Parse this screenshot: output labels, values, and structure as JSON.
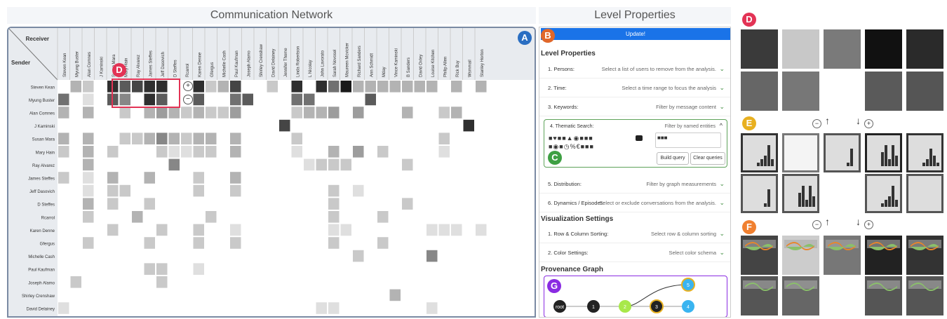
{
  "titles": {
    "network": "Communication Network",
    "levels": "Level Properties"
  },
  "matrix": {
    "corner_receiver": "Receiver",
    "corner_sender": "Sender",
    "columns": [
      "Steven Kean",
      "Myung Buster",
      "Alan Comnes",
      "J Kaminski",
      "Susan Mara",
      "Mary Hain",
      "Ray Alvarez",
      "James Steffes",
      "Jeff Dasovich",
      "D Steffes",
      "Rcarrol",
      "Karen Denne",
      "Gfergus",
      "Michelle Cash",
      "Paul Kaufman",
      "Joseph Alamo",
      "Shirley Crenshaw",
      "David Delainey",
      "Jennifer Thome",
      "Linda Robertson",
      "L Nicolay",
      "John Lavorato",
      "Sarah Novosel",
      "Maureen Mcvicker",
      "Richard Sanders",
      "Ann Schmidt",
      "Mday",
      "Vince Kaminski",
      "B Sanders",
      "David Oxley",
      "Louise Kitchen",
      "Philip Allen",
      "Rick Buy",
      "Wsmmail",
      "Stanley Horton"
    ],
    "rows": [
      "Steven Kean",
      "Myung Buster",
      "Alan Comnes",
      "J Kaminski",
      "Susan Mara",
      "Mary Hain",
      "Ray Alvarez",
      "James Steffes",
      "Jeff Dasovich",
      "D Steffes",
      "Rcarrol",
      "Karen Denne",
      "Gfergus",
      "Michelle Cash",
      "Paul Kaufman",
      "Joseph Alamo",
      "Shirley Crenshaw",
      "David Delainey"
    ],
    "cells": [
      [
        0,
        3,
        2,
        0,
        9,
        7,
        8,
        9,
        9,
        0,
        0,
        9,
        2,
        3,
        8,
        0,
        0,
        2,
        0,
        9,
        0,
        9,
        6,
        10,
        3,
        3,
        3,
        3,
        3,
        3,
        3,
        0,
        3,
        0,
        3
      ],
      [
        6,
        0,
        1,
        0,
        7,
        5,
        0,
        9,
        7,
        0,
        0,
        7,
        0,
        0,
        6,
        7,
        0,
        0,
        0,
        6,
        6,
        0,
        0,
        0,
        0,
        7,
        0,
        0,
        0,
        0,
        0,
        0,
        0,
        0,
        0
      ],
      [
        3,
        0,
        3,
        0,
        0,
        2,
        0,
        3,
        4,
        3,
        2,
        3,
        2,
        2,
        4,
        0,
        0,
        0,
        0,
        2,
        3,
        3,
        4,
        0,
        4,
        0,
        0,
        0,
        3,
        0,
        0,
        2,
        3,
        0,
        0
      ],
      [
        0,
        0,
        0,
        0,
        0,
        0,
        0,
        0,
        0,
        0,
        0,
        0,
        0,
        0,
        0,
        0,
        0,
        0,
        8,
        0,
        0,
        0,
        0,
        0,
        0,
        0,
        0,
        0,
        0,
        0,
        0,
        0,
        0,
        9,
        0
      ],
      [
        3,
        0,
        3,
        0,
        0,
        2,
        2,
        3,
        5,
        3,
        2,
        3,
        3,
        0,
        3,
        0,
        0,
        0,
        0,
        2,
        0,
        0,
        0,
        0,
        0,
        0,
        0,
        0,
        0,
        0,
        0,
        2,
        0,
        0,
        0
      ],
      [
        2,
        0,
        3,
        0,
        2,
        0,
        0,
        0,
        2,
        1,
        1,
        2,
        2,
        0,
        3,
        0,
        0,
        0,
        0,
        1,
        0,
        0,
        3,
        0,
        4,
        0,
        2,
        0,
        0,
        0,
        0,
        1,
        0,
        0,
        0
      ],
      [
        0,
        0,
        3,
        0,
        0,
        0,
        0,
        0,
        0,
        5,
        0,
        0,
        0,
        0,
        0,
        0,
        0,
        0,
        0,
        0,
        1,
        2,
        2,
        2,
        0,
        0,
        0,
        0,
        2,
        0,
        0,
        0,
        0,
        0,
        0
      ],
      [
        2,
        0,
        1,
        0,
        3,
        0,
        0,
        3,
        0,
        0,
        0,
        2,
        0,
        0,
        3,
        0,
        0,
        0,
        0,
        0,
        0,
        0,
        0,
        0,
        0,
        0,
        0,
        0,
        0,
        0,
        0,
        0,
        0,
        0,
        0
      ],
      [
        0,
        0,
        1,
        0,
        2,
        2,
        0,
        0,
        0,
        0,
        0,
        2,
        0,
        0,
        2,
        0,
        0,
        0,
        0,
        0,
        0,
        0,
        2,
        0,
        1,
        0,
        0,
        0,
        0,
        0,
        0,
        0,
        0,
        0,
        0
      ],
      [
        0,
        0,
        3,
        0,
        2,
        0,
        0,
        2,
        0,
        0,
        0,
        0,
        0,
        0,
        0,
        0,
        0,
        0,
        0,
        0,
        0,
        0,
        2,
        0,
        0,
        0,
        0,
        0,
        2,
        0,
        0,
        0,
        0,
        0,
        0
      ],
      [
        0,
        0,
        2,
        0,
        0,
        0,
        3,
        0,
        0,
        0,
        0,
        0,
        2,
        0,
        0,
        0,
        0,
        0,
        0,
        0,
        0,
        0,
        2,
        0,
        0,
        0,
        2,
        0,
        0,
        0,
        0,
        0,
        0,
        0,
        0
      ],
      [
        0,
        0,
        0,
        0,
        2,
        0,
        0,
        0,
        2,
        0,
        0,
        2,
        0,
        0,
        1,
        0,
        0,
        0,
        0,
        0,
        0,
        0,
        1,
        1,
        0,
        0,
        0,
        0,
        0,
        0,
        1,
        1,
        1,
        0,
        1
      ],
      [
        0,
        0,
        2,
        0,
        0,
        0,
        0,
        2,
        0,
        0,
        0,
        2,
        0,
        0,
        2,
        0,
        0,
        0,
        0,
        0,
        0,
        0,
        2,
        0,
        0,
        0,
        2,
        0,
        0,
        0,
        0,
        0,
        0,
        0,
        0
      ],
      [
        0,
        0,
        0,
        0,
        0,
        0,
        0,
        0,
        0,
        0,
        0,
        0,
        0,
        0,
        0,
        0,
        0,
        0,
        0,
        0,
        0,
        0,
        0,
        0,
        2,
        0,
        0,
        0,
        0,
        0,
        5,
        0,
        0,
        0,
        0
      ],
      [
        0,
        0,
        0,
        0,
        0,
        0,
        0,
        2,
        2,
        0,
        0,
        1,
        0,
        0,
        0,
        0,
        0,
        0,
        0,
        0,
        0,
        0,
        0,
        0,
        0,
        0,
        0,
        0,
        0,
        0,
        0,
        0,
        0,
        0,
        0
      ],
      [
        0,
        2,
        0,
        0,
        0,
        0,
        0,
        0,
        2,
        0,
        0,
        0,
        0,
        0,
        0,
        0,
        0,
        0,
        0,
        0,
        0,
        0,
        0,
        0,
        0,
        0,
        0,
        0,
        0,
        0,
        0,
        0,
        0,
        0,
        0
      ],
      [
        0,
        0,
        0,
        0,
        0,
        0,
        0,
        0,
        0,
        0,
        0,
        0,
        0,
        0,
        0,
        0,
        0,
        0,
        0,
        0,
        0,
        0,
        0,
        0,
        0,
        0,
        0,
        3,
        0,
        0,
        0,
        0,
        0,
        0,
        0
      ],
      [
        1,
        0,
        0,
        0,
        0,
        0,
        0,
        0,
        0,
        0,
        0,
        0,
        0,
        0,
        0,
        0,
        0,
        0,
        0,
        0,
        0,
        1,
        1,
        0,
        0,
        0,
        0,
        0,
        0,
        0,
        1,
        0,
        0,
        0,
        0
      ]
    ]
  },
  "badges": {
    "a": "A",
    "b": "B",
    "c": "C",
    "d": "D",
    "e": "E",
    "f": "F",
    "g": "G"
  },
  "badge_colors": {
    "a": "#2a6ec2",
    "b": "#e0672a",
    "c": "#3ea043",
    "d": "#e33355",
    "e": "#e8b020",
    "f": "#f08030",
    "g": "#8a2be2"
  },
  "levels": {
    "update_label": "Update!",
    "section_level": "Level Properties",
    "items": [
      {
        "label": "1. Persons:",
        "hint": "Select a list of users to remove from the analysis."
      },
      {
        "label": "2. Time:",
        "hint": "Select a time range to focus the analysis"
      },
      {
        "label": "3. Keywords:",
        "hint": "Filter by message content"
      }
    ],
    "thematic": {
      "label": "4. Thematic Search:",
      "hint": "Filter by named entities",
      "build": "Build query",
      "clear": "Clear queries"
    },
    "items2": [
      {
        "label": "5. Distribution:",
        "hint": "Filter by graph measurements"
      },
      {
        "label": "6. Dynamics / Episodes:",
        "hint": "Select or exclude conversations from the analysis."
      }
    ],
    "section_vis": "Visualization Settings",
    "vis_items": [
      {
        "label": "1. Row & Column Sorting:",
        "hint": "Select row & column sorting"
      },
      {
        "label": "2. Color Settings:",
        "hint": "Select color schema"
      }
    ],
    "section_prov": "Provenance Graph",
    "prov_nodes": [
      "root",
      "1",
      "2",
      "3",
      "4",
      "5"
    ]
  },
  "overview_d": [
    [
      "#3a3a3a",
      "#c8c8c8",
      "#7a7a7a",
      "#111111",
      "#2a2a2a"
    ],
    [
      "#666666",
      "#777777",
      "",
      "#5a5a5a",
      "#555555"
    ]
  ]
}
